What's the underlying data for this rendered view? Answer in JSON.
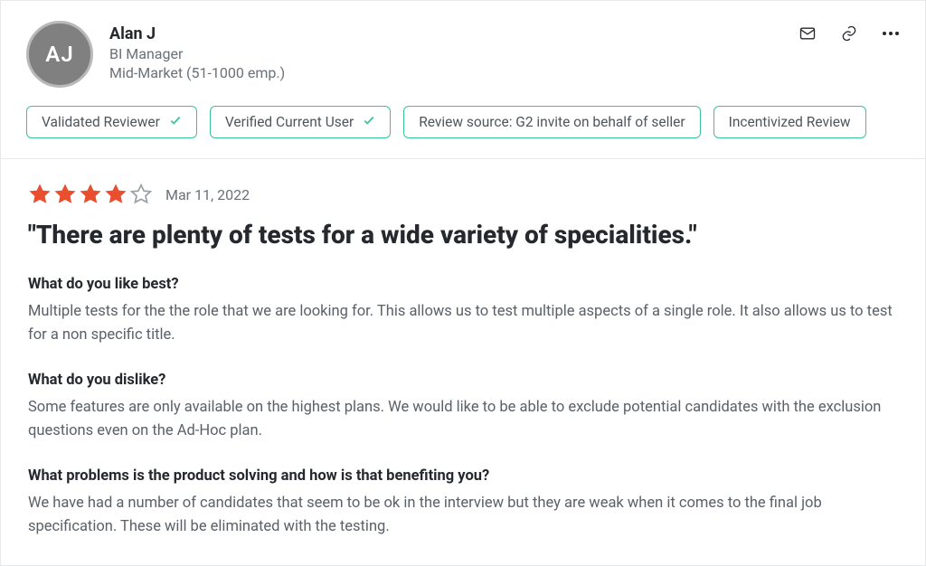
{
  "reviewer": {
    "initials": "AJ",
    "name": "Alan J",
    "role": "BI Manager",
    "market": "Mid-Market (51-1000 emp.)"
  },
  "badges": {
    "validated": "Validated Reviewer",
    "verified": "Verified Current User",
    "source": "Review source: G2 invite on behalf of seller",
    "incentivized": "Incentivized Review"
  },
  "review": {
    "rating": 4,
    "max_rating": 5,
    "date": "Mar 11, 2022",
    "title": "\"There are plenty of tests for a wide variety of specialities.\"",
    "q_like": "What do you like best?",
    "a_like": "Multiple tests for the the role that we are looking for. This allows us to test multiple aspects of a single role. It also allows us to test for a non specific title.",
    "q_dislike": "What do you dislike?",
    "a_dislike": "Some features are only available on the highest plans. We would like to be able to exclude potential candidates with the exclusion questions even on the Ad-Hoc plan.",
    "q_problems": "What problems is the product solving and how is that benefiting you?",
    "a_problems": "We have had a number of candidates that seem to be ok in the interview but they are weak when it comes to the final job specification. These will be eliminated with the testing."
  }
}
